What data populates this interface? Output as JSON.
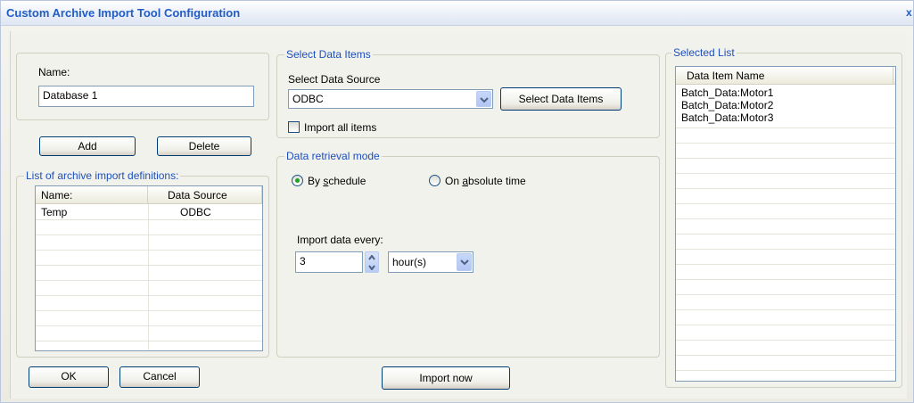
{
  "window": {
    "title": "Custom Archive Import Tool Configuration",
    "close_glyph": "x"
  },
  "name_section": {
    "label": "Name:",
    "value": "Database 1"
  },
  "buttons": {
    "add": "Add",
    "delete": "Delete",
    "select_data_items": "Select Data Items",
    "ok": "OK",
    "cancel": "Cancel",
    "import_now": "Import now"
  },
  "definitions": {
    "legend": "List of archive import definitions:",
    "columns": [
      "Name:",
      "Data Source"
    ],
    "rows": [
      {
        "name": "Temp",
        "source": "ODBC"
      }
    ]
  },
  "select_data_items": {
    "legend": "Select Data Items",
    "source_label": "Select Data Source",
    "source_value": "ODBC",
    "import_all_label": "Import all items",
    "import_all_checked": false
  },
  "retrieval": {
    "legend": "Data retrieval mode",
    "by_schedule_label": "By schedule",
    "by_schedule_mnemonic": "s",
    "absolute_label": "On absolute time",
    "selected": "by_schedule",
    "import_every_label": "Import data every:",
    "interval_value": "3",
    "interval_unit": "hour(s)"
  },
  "selected_list": {
    "legend": "Selected List",
    "column": "Data Item Name",
    "items": [
      "Batch_Data:Motor1",
      "Batch_Data:Motor2",
      "Batch_Data:Motor3"
    ]
  },
  "colors": {
    "title": "#215dc6",
    "legend": "#1d4fbd",
    "radio_dot": "#21a121"
  },
  "icons": {
    "combo_arrow": "chevron-down-icon",
    "spin": "spin-arrows-icon"
  }
}
